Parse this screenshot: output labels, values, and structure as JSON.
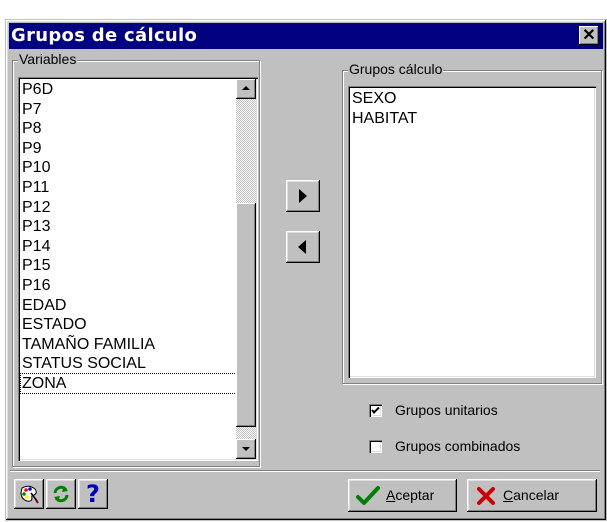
{
  "window": {
    "title": "Grupos de cálculo",
    "close_glyph": "✕"
  },
  "variables": {
    "legend": "Variables",
    "items": [
      "P6D",
      "P7",
      "P8",
      "P9",
      "P10",
      "P11",
      "P12",
      "P13",
      "P14",
      "P15",
      "P16",
      "EDAD",
      "ESTADO",
      "TAMAÑO FAMILIA",
      "STATUS SOCIAL",
      "ZONA"
    ],
    "focused_item": "ZONA",
    "scroll_position": 0.9
  },
  "grupos": {
    "legend": "Grupos cálculo",
    "items": [
      "SEXO",
      "HABITAT"
    ]
  },
  "transfer": {
    "add_icon": "arrow-right-icon",
    "remove_icon": "arrow-left-icon"
  },
  "options": {
    "unitarios": {
      "label": "Grupos unitarios",
      "checked": true
    },
    "combinados": {
      "label": "Grupos combinados",
      "checked": false
    }
  },
  "toolbar": {
    "icons": [
      "palette-icon",
      "refresh-icon",
      "help-icon"
    ],
    "help_glyph": "?"
  },
  "buttons": {
    "aceptar": {
      "label_first": "A",
      "label_rest": "ceptar",
      "icon": "checkmark-icon",
      "icon_color": "#008000"
    },
    "cancelar": {
      "label_first": "C",
      "label_rest": "ancelar",
      "icon": "x-icon",
      "icon_color": "#cc0000"
    }
  },
  "colors": {
    "title_bar": "#000080",
    "face": "#c0c0c0"
  }
}
